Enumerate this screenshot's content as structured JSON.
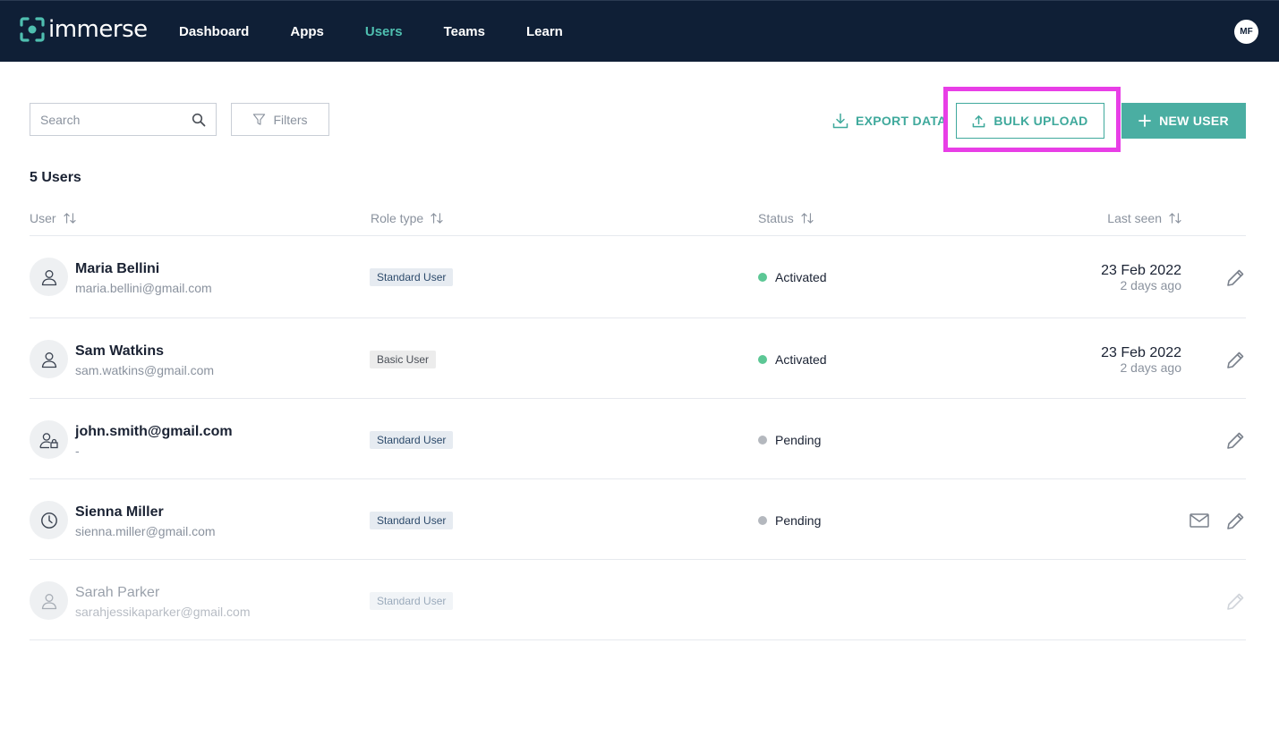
{
  "app": {
    "logo_text": "immerse"
  },
  "nav": {
    "items": [
      {
        "label": "Dashboard",
        "active": false
      },
      {
        "label": "Apps",
        "active": false
      },
      {
        "label": "Users",
        "active": true
      },
      {
        "label": "Teams",
        "active": false
      },
      {
        "label": "Learn",
        "active": false
      }
    ],
    "avatar_initials": "MF"
  },
  "toolbar": {
    "search_placeholder": "Search",
    "filters_label": "Filters",
    "export_label": "EXPORT DATA",
    "bulk_upload_label": "BULK UPLOAD",
    "new_user_label": "NEW USER"
  },
  "user_count": "5 Users",
  "table": {
    "columns": {
      "user": "User",
      "role": "Role type",
      "status": "Status",
      "last_seen": "Last seen"
    },
    "rows": [
      {
        "name": "Maria Bellini",
        "email": "maria.bellini@gmail.com",
        "role": "Standard User",
        "role_kind": "standard",
        "status": "Activated",
        "status_color": "green",
        "last_seen": "23 Feb 2022",
        "ago": "2 days ago",
        "avatar_icon": "user-icon"
      },
      {
        "name": "Sam Watkins",
        "email": "sam.watkins@gmail.com",
        "role": "Basic User",
        "role_kind": "basic",
        "status": "Activated",
        "status_color": "green",
        "last_seen": "23 Feb 2022",
        "ago": "2 days ago",
        "avatar_icon": "user-icon"
      },
      {
        "name": "john.smith@gmail.com",
        "email": "-",
        "role": "Standard User",
        "role_kind": "standard",
        "status": "Pending",
        "status_color": "grey",
        "last_seen": "",
        "ago": "",
        "avatar_icon": "user-lock-icon"
      },
      {
        "name": "Sienna Miller",
        "email": "sienna.miller@gmail.com",
        "role": "Standard User",
        "role_kind": "standard",
        "status": "Pending",
        "status_color": "grey",
        "last_seen": "",
        "ago": "",
        "avatar_icon": "clock-icon"
      },
      {
        "name": "Sarah Parker",
        "email": "sarahjessikaparker@gmail.com",
        "role": "Standard User",
        "role_kind": "standard",
        "status": "",
        "status_color": "",
        "last_seen": "",
        "ago": "",
        "avatar_icon": "user-icon",
        "disabled": true
      }
    ]
  },
  "colors": {
    "nav_bg": "#0f1f36",
    "accent": "#4aaea2",
    "highlight": "#e83ee6"
  }
}
